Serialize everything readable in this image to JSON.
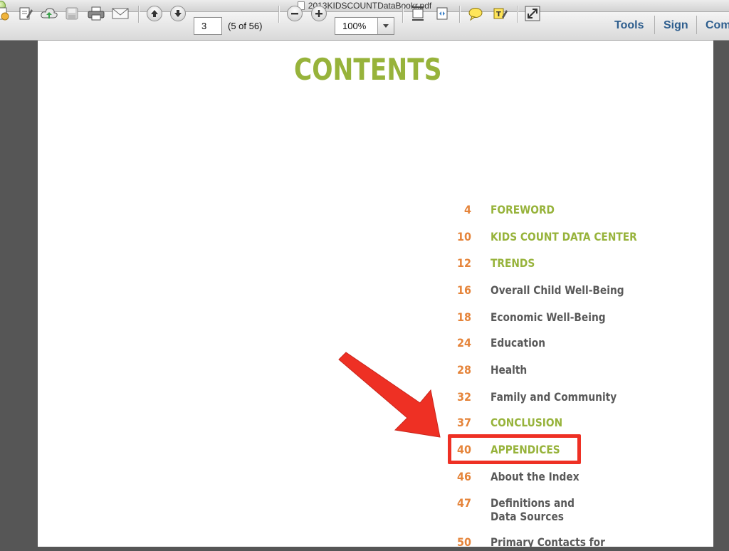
{
  "window": {
    "title": "2013KIDSCOUNTDataBookr.pdf"
  },
  "toolbar": {
    "page_number": "3",
    "page_count": "(5 of 56)",
    "zoom": "100%",
    "tools_label": "Tools",
    "sign_label": "Sign",
    "comment_label": "Com"
  },
  "document": {
    "heading": "CONTENTS",
    "toc": [
      {
        "page": "4",
        "label": "FOREWORD",
        "style": "section"
      },
      {
        "page": "10",
        "label": "KIDS COUNT DATA CENTER",
        "style": "section"
      },
      {
        "page": "12",
        "label": "TRENDS",
        "style": "section"
      },
      {
        "page": "16",
        "label": "Overall Child Well-Being",
        "style": "sub"
      },
      {
        "page": "18",
        "label": "Economic Well-Being",
        "style": "sub"
      },
      {
        "page": "24",
        "label": "Education",
        "style": "sub"
      },
      {
        "page": "28",
        "label": "Health",
        "style": "sub"
      },
      {
        "page": "32",
        "label": "Family and Community",
        "style": "sub"
      },
      {
        "page": "37",
        "label": "CONCLUSION",
        "style": "section"
      },
      {
        "page": "40",
        "label": "APPENDICES",
        "style": "section"
      },
      {
        "page": "46",
        "label": "About the Index",
        "style": "sub"
      },
      {
        "page": "47",
        "label": "Definitions and",
        "label2": "Data Sources",
        "style": "sub"
      },
      {
        "page": "50",
        "label": "Primary Contacts for",
        "style": "sub"
      }
    ]
  },
  "colors": {
    "accent_green": "#97b33b",
    "page_number_orange": "#e5843a",
    "annotation_red": "#ee3024"
  }
}
